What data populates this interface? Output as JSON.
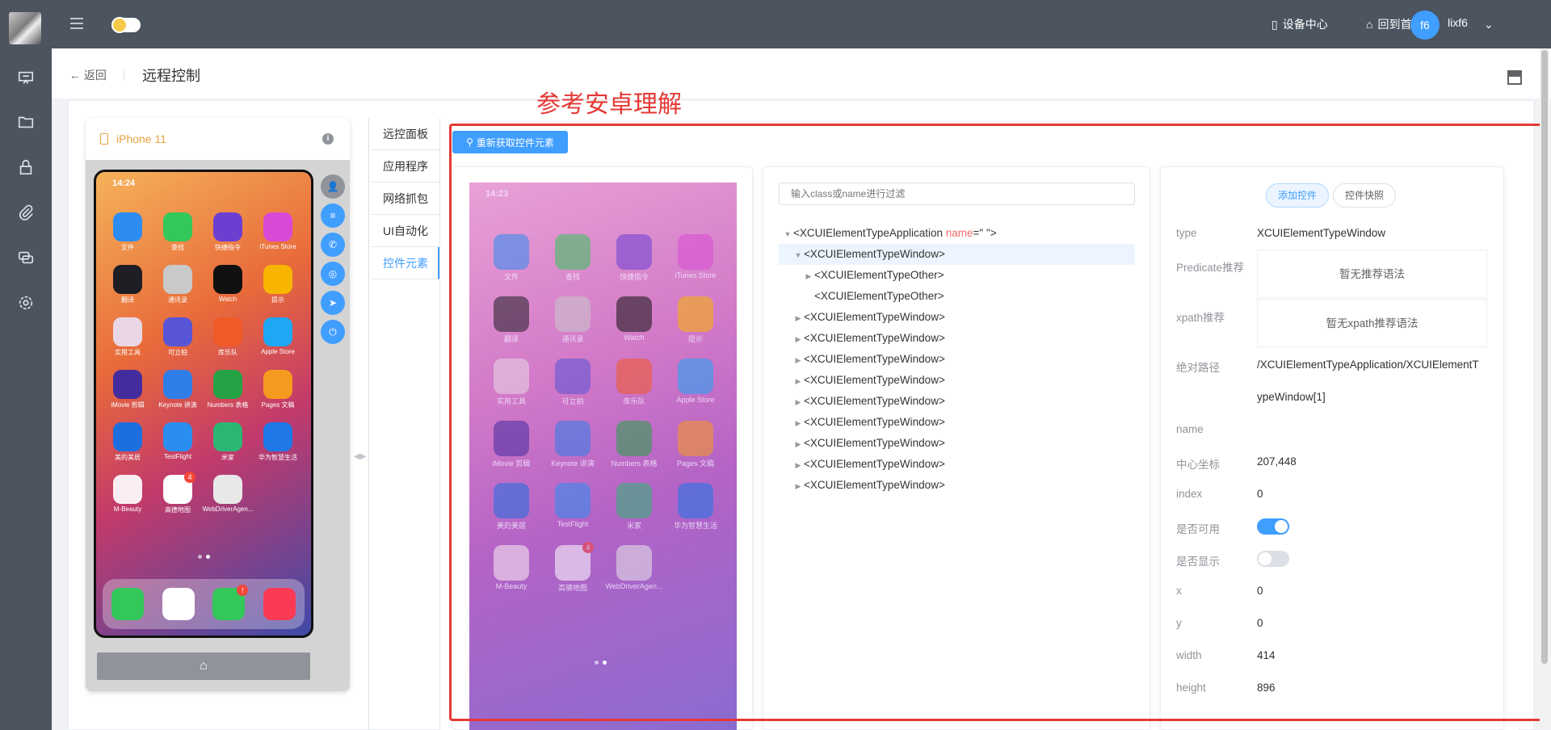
{
  "topbar": {
    "device_center": "设备中心",
    "back_home": "回到首页",
    "avatar_text": "f6",
    "username": "lixf6"
  },
  "header": {
    "back": "返回",
    "title": "远程控制"
  },
  "annotation": "参考安卓理解",
  "device": {
    "name": "iPhone 11",
    "status_time": "14:24",
    "status_time_b": "14:23",
    "apps": [
      {
        "label": "文件",
        "color": "#2d8cf0"
      },
      {
        "label": "查找",
        "color": "#34c759"
      },
      {
        "label": "快捷指令",
        "color": "#6c3fd1"
      },
      {
        "label": "iTunes Store",
        "color": "#d84ad6"
      },
      {
        "label": "翻译",
        "color": "#1e1e24"
      },
      {
        "label": "通讯录",
        "color": "#c9c9c9"
      },
      {
        "label": "Watch",
        "color": "#111111"
      },
      {
        "label": "提示",
        "color": "#f7b500"
      },
      {
        "label": "实用工具",
        "color": "#e9d7e6"
      },
      {
        "label": "可立拍",
        "color": "#5856d6"
      },
      {
        "label": "库乐队",
        "color": "#f05a28"
      },
      {
        "label": "Apple Store",
        "color": "#1ea7f5"
      },
      {
        "label": "iMovie 剪辑",
        "color": "#442c9e"
      },
      {
        "label": "Keynote 讲演",
        "color": "#2f7ee8"
      },
      {
        "label": "Numbers 表格",
        "color": "#25a244"
      },
      {
        "label": "Pages 文稿",
        "color": "#f59a1f"
      },
      {
        "label": "美的美居",
        "color": "#1d6fe0"
      },
      {
        "label": "TestFlight",
        "color": "#2a8ef0"
      },
      {
        "label": "米家",
        "color": "#2bb673"
      },
      {
        "label": "华为智慧生活",
        "color": "#1e78e8"
      },
      {
        "label": "M-Beauty",
        "color": "#fbeef2"
      },
      {
        "label": "高德地图",
        "color": "#ffffff",
        "badge": "4"
      },
      {
        "label": "WebDriverAgen...",
        "color": "#e8e8e8"
      }
    ],
    "dock": [
      {
        "color": "#34c759"
      },
      {
        "color": "#ffffff"
      },
      {
        "color": "#34c759",
        "badge": "!"
      },
      {
        "color": "#fa3a55"
      }
    ],
    "home_glyph": "⌂"
  },
  "vtabs": [
    "远控面板",
    "应用程序",
    "网络抓包",
    "UI自动化",
    "控件元素"
  ],
  "inspector": {
    "refresh_label": "重新获取控件元素",
    "filter_placeholder": "输入class或name进行过滤",
    "tree": [
      {
        "text": "<XCUIElementTypeApplication ",
        "attr": "name",
        "rest": "=\" \">",
        "level": 0,
        "expanded": true
      },
      {
        "text": "<XCUIElementTypeWindow>",
        "level": 1,
        "expanded": true,
        "selected": true
      },
      {
        "text": "<XCUIElementTypeOther>",
        "level": 2,
        "expanded": false
      },
      {
        "text": "<XCUIElementTypeOther>",
        "level": 2,
        "leaf": true
      },
      {
        "text": "<XCUIElementTypeWindow>",
        "level": 1
      },
      {
        "text": "<XCUIElementTypeWindow>",
        "level": 1
      },
      {
        "text": "<XCUIElementTypeWindow>",
        "level": 1
      },
      {
        "text": "<XCUIElementTypeWindow>",
        "level": 1
      },
      {
        "text": "<XCUIElementTypeWindow>",
        "level": 1
      },
      {
        "text": "<XCUIElementTypeWindow>",
        "level": 1
      },
      {
        "text": "<XCUIElementTypeWindow>",
        "level": 1
      },
      {
        "text": "<XCUIElementTypeWindow>",
        "level": 1
      },
      {
        "text": "<XCUIElementTypeWindow>",
        "level": 1
      }
    ],
    "add_control": "添加控件",
    "control_snapshot": "控件快照",
    "props": {
      "type_label": "type",
      "type_value": "XCUIElementTypeWindow",
      "predicate_label": "Predicate推荐",
      "predicate_value": "暂无推荐语法",
      "xpath_label": "xpath推荐",
      "xpath_value": "暂无xpath推荐语法",
      "abs_label": "绝对路径",
      "abs_value_1": "/XCUIElementTypeApplication/XCUIElementT",
      "abs_value_2": "ypeWindow[1]",
      "name_label": "name",
      "name_value": "",
      "center_label": "中心坐标",
      "center_value": "207,448",
      "index_label": "index",
      "index_value": "0",
      "enabled_label": "是否可用",
      "enabled": true,
      "visible_label": "是否显示",
      "visible": false,
      "x_label": "x",
      "x_value": "0",
      "y_label": "y",
      "y_value": "0",
      "width_label": "width",
      "width_value": "414",
      "height_label": "height",
      "height_value": "896"
    }
  }
}
